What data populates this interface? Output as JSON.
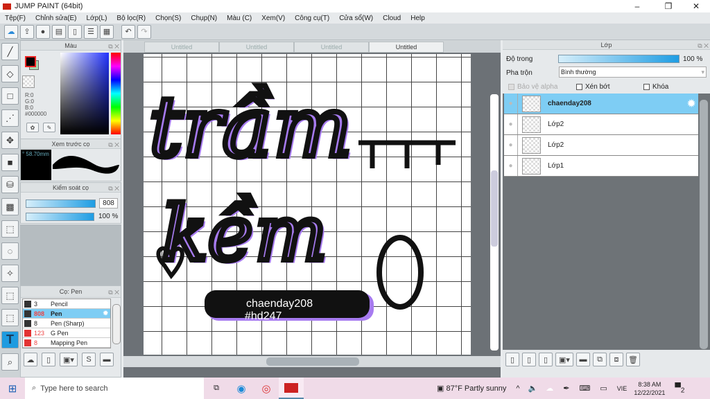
{
  "window": {
    "title": "JUMP PAINT (64bit)"
  },
  "menu": [
    "Tệp(F)",
    "Chỉnh sửa(E)",
    "Lớp(L)",
    "Bộ lọc(R)",
    "Chọn(S)",
    "Chụp(N)",
    "Màu (C)",
    "Xem(V)",
    "Công cụ(T)",
    "Cửa sổ(W)",
    "Cloud",
    "Help"
  ],
  "color_panel": {
    "title": "Màu",
    "r": "R:0",
    "g": "G:0",
    "b": "B:0",
    "hex": "#000000",
    "fg": "#000000",
    "bg": "#a8d8b0"
  },
  "brush_preview": {
    "title": "Xem trước cọ",
    "size": "° 58.70mm"
  },
  "brush_control": {
    "title": "Kiểm soát cọ",
    "size": "808",
    "opacity": "100 %"
  },
  "brush_list": {
    "title": "Cọ: Pen",
    "items": [
      {
        "size": "3",
        "name": "Pencil",
        "color": "#333333",
        "selected": false
      },
      {
        "size": "808",
        "name": "Pen",
        "color": "#333333",
        "selected": true
      },
      {
        "size": "8",
        "name": "Pen (Sharp)",
        "color": "#333333",
        "selected": false
      },
      {
        "size": "123",
        "name": "G Pen",
        "color": "#e33333",
        "selected": false
      },
      {
        "size": "8",
        "name": "Mapping Pen",
        "color": "#e33333",
        "selected": false
      }
    ]
  },
  "tabs": [
    "Untitled",
    "Untitled",
    "Untitled",
    "Untitled"
  ],
  "artwork": {
    "line1": "trầm",
    "line2": "kềm",
    "label1": "chaenday208",
    "label2": "#hd247"
  },
  "layer_panel": {
    "title": "Lớp",
    "opacity_label": "Độ trong",
    "opacity": "100 %",
    "blend_label": "Pha trộn",
    "blend": "Bình thường",
    "protect_alpha": "Bảo vệ alpha",
    "clip": "Xén bớt",
    "lock": "Khóa",
    "layers": [
      {
        "name": "chaenday208",
        "selected": true
      },
      {
        "name": "Lớp2",
        "selected": false
      },
      {
        "name": "Lớp2",
        "selected": false
      },
      {
        "name": "Lớp1",
        "selected": false
      }
    ]
  },
  "taskbar": {
    "search": "Type here to search",
    "weather": "87°F  Partly sunny",
    "lang": "VIE",
    "time": "8:38 AM",
    "date": "12/22/2021",
    "notifications": "2"
  }
}
